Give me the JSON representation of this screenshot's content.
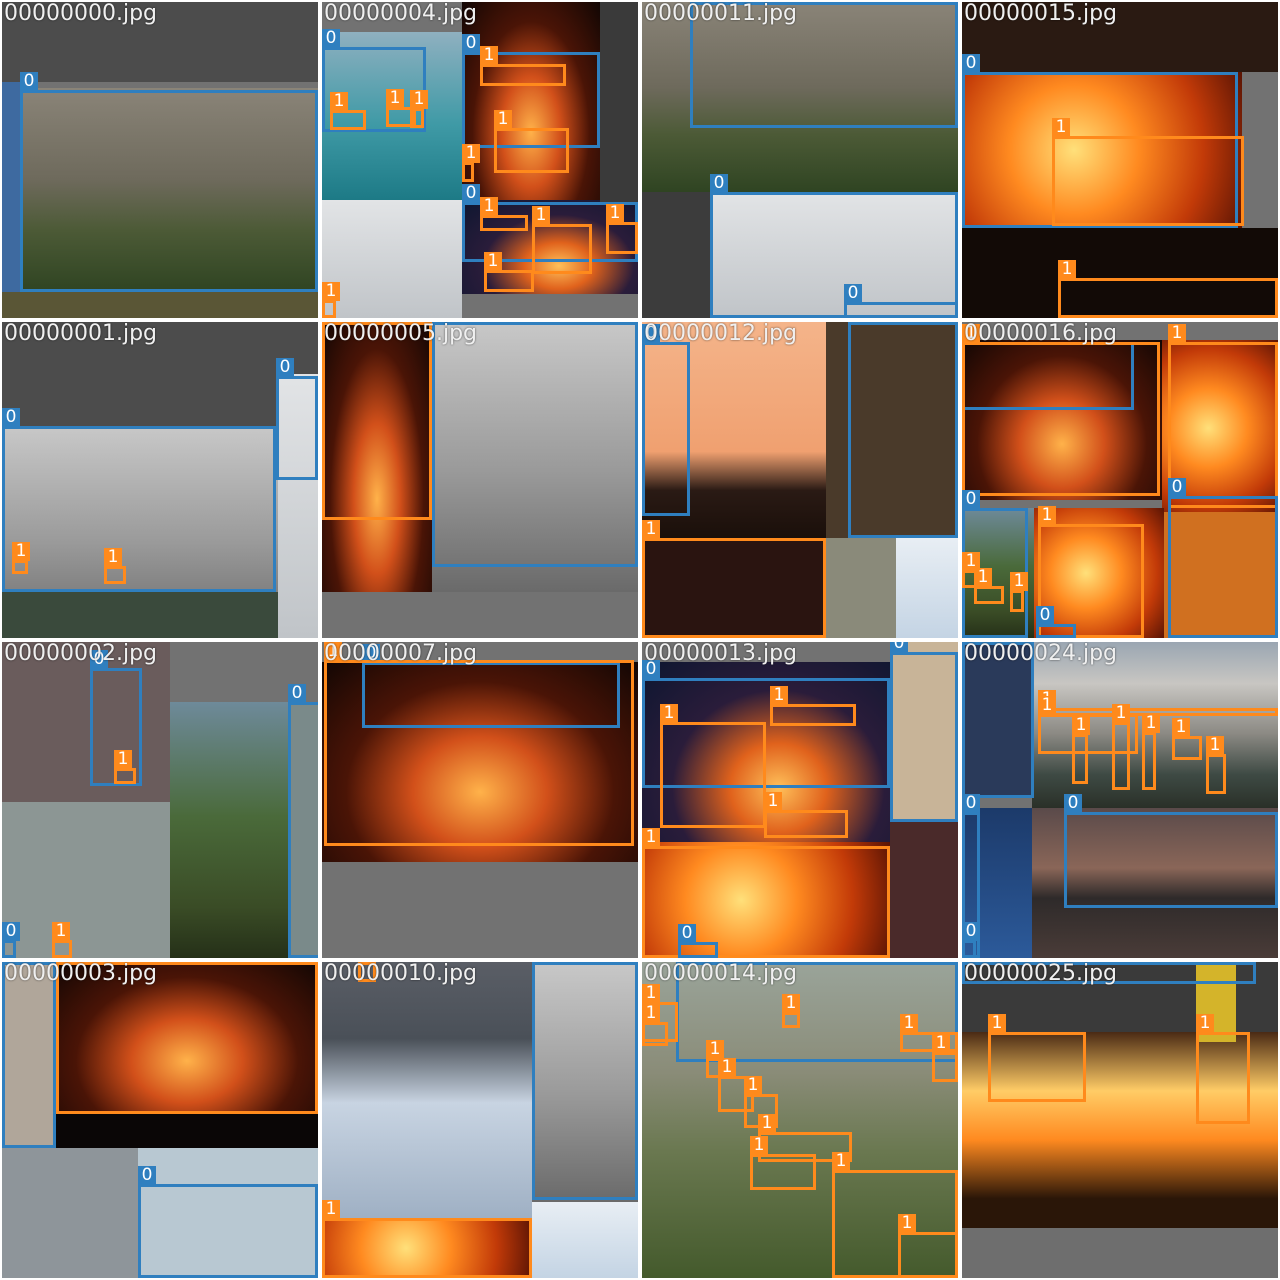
{
  "class_colors": {
    "0": "#2f7fbf",
    "1": "#ff8a1c"
  },
  "tiles": [
    {
      "filename": "00000000.jpg"
    },
    {
      "filename": "00000004.jpg"
    },
    {
      "filename": "00000011.jpg"
    },
    {
      "filename": "00000015.jpg"
    },
    {
      "filename": "00000001.jpg"
    },
    {
      "filename": "00000005.jpg"
    },
    {
      "filename": "00000012.jpg"
    },
    {
      "filename": "00000016.jpg"
    },
    {
      "filename": "00000002.jpg"
    },
    {
      "filename": "00000007.jpg"
    },
    {
      "filename": "00000013.jpg"
    },
    {
      "filename": "00000024.jpg"
    },
    {
      "filename": "00000003.jpg"
    },
    {
      "filename": "00000010.jpg"
    },
    {
      "filename": "00000014.jpg"
    },
    {
      "filename": "00000025.jpg"
    }
  ]
}
